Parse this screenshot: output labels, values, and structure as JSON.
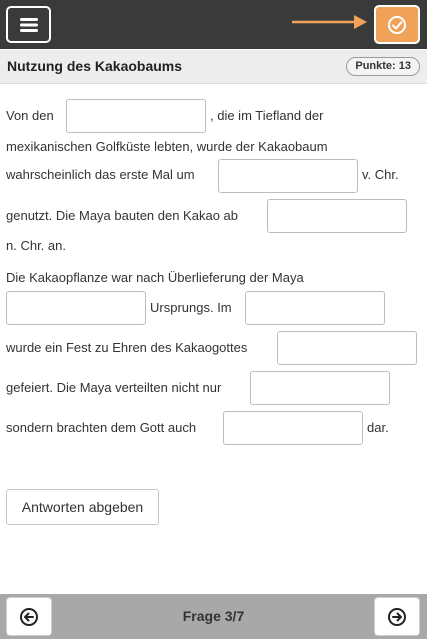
{
  "header": {
    "menu_icon": "hamburger-menu-icon",
    "check_icon": "check-circle-icon",
    "accent_color": "#f0a259"
  },
  "exercise": {
    "title": "Nutzung des Kakaobaums",
    "points_badge": "Punkte: 13"
  },
  "text": {
    "s1": "Von den",
    "s2": ", die im Tiefland der",
    "s3": "mexikanischen Golfküste lebten, wurde der Kakaobaum",
    "s4": "wahrscheinlich das erste Mal um",
    "s5": "v. Chr.",
    "s6": "genutzt. Die Maya bauten den Kakao ab",
    "s7": "n. Chr. an.",
    "s8": "Die Kakaopflanze war nach Überlieferung der Maya",
    "s9": "Ursprungs. Im",
    "s10": "wurde ein Fest zu Ehren des Kakaogottes",
    "s11": "gefeiert. Die Maya verteilten nicht nur",
    "s12": "sondern brachten dem Gott auch",
    "s13": "dar."
  },
  "gaps": [
    "",
    "",
    "",
    "",
    "",
    "",
    "",
    ""
  ],
  "submit_label": "Antworten abgeben",
  "footer": {
    "question_label": "Frage 3/7",
    "prev_icon": "arrow-left-circle-icon",
    "next_icon": "arrow-right-circle-icon"
  }
}
